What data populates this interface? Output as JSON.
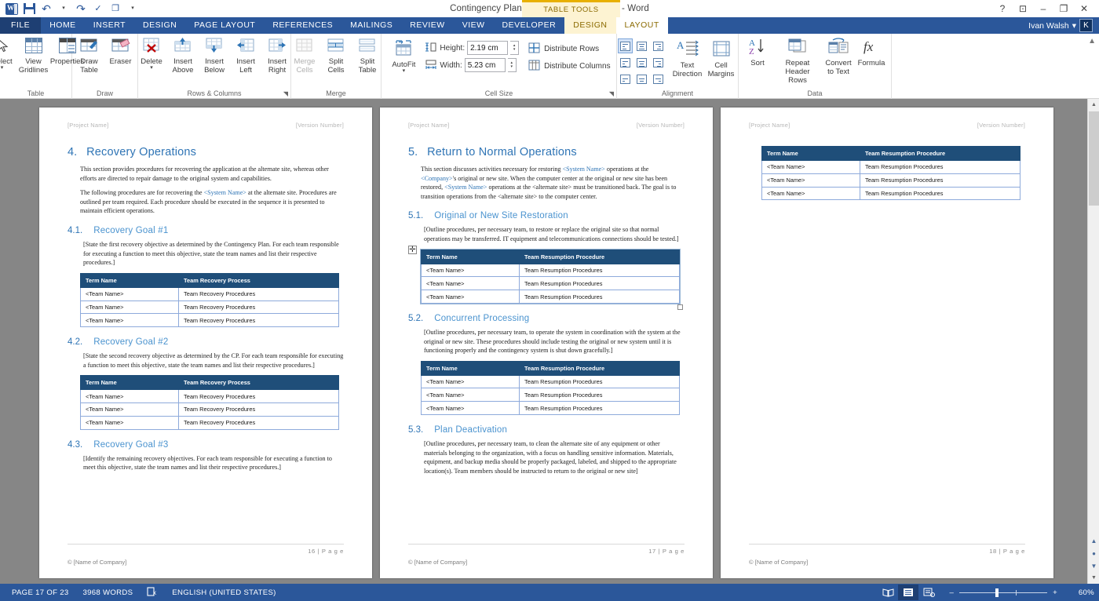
{
  "titlebar": {
    "doc_title": "Contingency Plan Template - Blue Theme - Word",
    "qat": [
      {
        "name": "word-logo",
        "label": "W"
      },
      {
        "name": "save",
        "label": "Save"
      },
      {
        "name": "undo",
        "label": "Undo"
      },
      {
        "name": "redo",
        "label": "Repeat"
      },
      {
        "name": "spelling",
        "label": "Spelling & Grammar"
      },
      {
        "name": "open-recent",
        "label": "Open"
      },
      {
        "name": "customize-qat",
        "label": "Customize Quick Access Toolbar"
      }
    ],
    "context_banner": "TABLE TOOLS",
    "window_controls": [
      "?",
      "ribbon-display",
      "–",
      "❐",
      "✕"
    ],
    "user_name": "Ivan Walsh",
    "avatar_initial": "K"
  },
  "tabs": [
    {
      "label": "FILE",
      "active": false,
      "kind": "file"
    },
    {
      "label": "HOME",
      "active": false,
      "kind": "normal"
    },
    {
      "label": "INSERT",
      "active": false,
      "kind": "normal"
    },
    {
      "label": "DESIGN",
      "active": false,
      "kind": "normal"
    },
    {
      "label": "PAGE LAYOUT",
      "active": false,
      "kind": "normal"
    },
    {
      "label": "REFERENCES",
      "active": false,
      "kind": "normal"
    },
    {
      "label": "MAILINGS",
      "active": false,
      "kind": "normal"
    },
    {
      "label": "REVIEW",
      "active": false,
      "kind": "normal"
    },
    {
      "label": "VIEW",
      "active": false,
      "kind": "normal"
    },
    {
      "label": "DEVELOPER",
      "active": false,
      "kind": "normal"
    },
    {
      "label": "DESIGN",
      "active": false,
      "kind": "context"
    },
    {
      "label": "LAYOUT",
      "active": true,
      "kind": "context"
    }
  ],
  "ribbon": {
    "groups": [
      {
        "name": "table",
        "title": "Table",
        "buttons": [
          {
            "name": "select",
            "label": "Select",
            "sub": "",
            "caret": true
          },
          {
            "name": "view-gridlines",
            "label": "View",
            "sub": "Gridlines",
            "caret": false
          },
          {
            "name": "properties",
            "label": "Properties",
            "sub": "",
            "caret": false
          }
        ]
      },
      {
        "name": "draw",
        "title": "Draw",
        "buttons": [
          {
            "name": "draw-table",
            "label": "Draw",
            "sub": "Table",
            "caret": false
          },
          {
            "name": "eraser",
            "label": "Eraser",
            "sub": "",
            "caret": false
          }
        ]
      },
      {
        "name": "rows-columns",
        "title": "Rows & Columns",
        "buttons": [
          {
            "name": "delete",
            "label": "Delete",
            "sub": "",
            "caret": true
          },
          {
            "name": "insert-above",
            "label": "Insert",
            "sub": "Above",
            "caret": false
          },
          {
            "name": "insert-below",
            "label": "Insert",
            "sub": "Below",
            "caret": false
          },
          {
            "name": "insert-left",
            "label": "Insert",
            "sub": "Left",
            "caret": false
          },
          {
            "name": "insert-right",
            "label": "Insert",
            "sub": "Right",
            "caret": false
          }
        ]
      },
      {
        "name": "merge",
        "title": "Merge",
        "buttons": [
          {
            "name": "merge-cells",
            "label": "Merge",
            "sub": "Cells",
            "caret": false,
            "disabled": true
          },
          {
            "name": "split-cells",
            "label": "Split",
            "sub": "Cells",
            "caret": false
          },
          {
            "name": "split-table",
            "label": "Split",
            "sub": "Table",
            "caret": false
          }
        ]
      },
      {
        "name": "cell-size",
        "title": "Cell Size",
        "autofit": {
          "label": "AutoFit",
          "caret": true
        },
        "height_label": "Height:",
        "height_value": "2.19 cm",
        "width_label": "Width:",
        "width_value": "5.23 cm",
        "distribute_rows": "Distribute Rows",
        "distribute_columns": "Distribute Columns"
      },
      {
        "name": "alignment",
        "title": "Alignment",
        "buttons": [
          {
            "name": "text-direction",
            "label": "Text",
            "sub": "Direction"
          },
          {
            "name": "cell-margins",
            "label": "Cell",
            "sub": "Margins"
          }
        ],
        "align_cells": [
          "align-top-left",
          "align-top-center",
          "align-top-right",
          "align-center-left",
          "align-center",
          "align-center-right",
          "align-bottom-left",
          "align-bottom-center",
          "align-bottom-right"
        ],
        "selected_align": "align-top-left"
      },
      {
        "name": "data",
        "title": "Data",
        "buttons": [
          {
            "name": "sort",
            "label": "Sort",
            "sub": "",
            "icon": "AZ↓"
          },
          {
            "name": "repeat-header-rows",
            "label": "Repeat",
            "sub": "Header Rows"
          },
          {
            "name": "convert-to-text",
            "label": "Convert",
            "sub": "to Text"
          },
          {
            "name": "formula",
            "label": "Formula",
            "sub": "",
            "icon": "fx"
          }
        ]
      }
    ]
  },
  "document": {
    "pages": [
      {
        "name": "page-16",
        "header_left": "[Project Name]",
        "header_right": "[Version Number]",
        "heading1": {
          "num": "4.",
          "text": "Recovery Operations"
        },
        "paras": [
          "This section provides procedures for recovering the application at the alternate site, whereas other efforts are directed to repair damage to the original system and capabilities."
        ],
        "para_with_ph": {
          "a": "The following procedures are for recovering the ",
          "ph": "<System Name>",
          "b": " at the alternate site. Procedures are outlined per team required. Each procedure should be executed in the sequence it is presented to maintain efficient operations."
        },
        "sections": [
          {
            "num": "4.1.",
            "title": "Recovery Goal #1",
            "body": "[State the first recovery objective as determined by the Contingency Plan. For each team responsible for executing a function to meet this objective, state the team names and list their respective procedures.]",
            "table": {
              "headers": [
                "Term Name",
                "Team Recovery Process"
              ],
              "rows": [
                [
                  "<Team Name>",
                  "Team Recovery Procedures"
                ],
                [
                  "<Team Name>",
                  "Team Recovery Procedures"
                ],
                [
                  "<Team Name>",
                  "Team Recovery Procedures"
                ]
              ]
            }
          },
          {
            "num": "4.2.",
            "title": "Recovery Goal #2",
            "body": "[State the second recovery objective as determined by the CP. For each team responsible for executing a function to meet this objective, state the team names and list their respective procedures.]",
            "table": {
              "headers": [
                "Term Name",
                "Team Recovery Process"
              ],
              "rows": [
                [
                  "<Team Name>",
                  "Team Recovery Procedures"
                ],
                [
                  "<Team Name>",
                  "Team Recovery Procedures"
                ],
                [
                  "<Team Name>",
                  "Team Recovery Procedures"
                ]
              ]
            }
          },
          {
            "num": "4.3.",
            "title": "Recovery Goal #3",
            "body": "[Identify the remaining recovery objectives. For each team responsible for executing a function to meet this objective, state the team names and list their respective procedures.]",
            "table": null
          }
        ],
        "footer_page": "16 | P a g e",
        "footer_company": "© [Name of Company]"
      },
      {
        "name": "page-17",
        "header_left": "[Project Name]",
        "header_right": "[Version Number]",
        "heading1": {
          "num": "5.",
          "text": "Return to Normal Operations"
        },
        "intro": {
          "a": "This section discusses activities necessary for restoring ",
          "ph1": "<System Name>",
          "b": " operations at the ",
          "ph2": "<Company>",
          "c": "'s original or new site. When the computer center at the original or new site has been restored, ",
          "ph3": "<System Name>",
          "d": " operations at the <alternate site> must be transitioned back. The goal is to transition operations from the <alternate site> to the computer center."
        },
        "sections": [
          {
            "num": "5.1.",
            "title": "Original or New Site Restoration",
            "body": "[Outline procedures, per necessary team, to restore or replace the original site so that normal operations may be transferred. IT equipment and telecommunications connections should be tested.]",
            "selected": true,
            "table": {
              "headers": [
                "Term Name",
                "Team Resumption Procedure"
              ],
              "rows": [
                [
                  "<Team Name>",
                  "Team Resumption Procedures"
                ],
                [
                  "<Team Name>",
                  "Team Resumption Procedures"
                ],
                [
                  "<Team Name>",
                  "Team Resumption Procedures"
                ]
              ]
            }
          },
          {
            "num": "5.2.",
            "title": "Concurrent Processing",
            "body": "[Outline procedures, per necessary team, to operate the system in coordination with the system at the original or new site. These procedures should include testing the original or new system until it is functioning properly and the contingency system is shut down gracefully.]",
            "selected": false,
            "table": {
              "headers": [
                "Term Name",
                "Team Resumption Procedure"
              ],
              "rows": [
                [
                  "<Team Name>",
                  "Team Resumption Procedures"
                ],
                [
                  "<Team Name>",
                  "Team Resumption Procedures"
                ],
                [
                  "<Team Name>",
                  "Team Resumption Procedures"
                ]
              ]
            }
          },
          {
            "num": "5.3.",
            "title": "Plan Deactivation",
            "body": "[Outline procedures, per necessary team, to clean the alternate site of any equipment or other materials belonging to the organization, with a focus on handling sensitive information. Materials, equipment, and backup media should be properly packaged, labeled, and shipped to the appropriate location(s). Team members should be instructed to return to the original or new site]",
            "selected": false,
            "table": null
          }
        ],
        "footer_page": "17 | P a g e",
        "footer_company": "© [Name of Company]"
      },
      {
        "name": "page-18",
        "header_left": "[Project Name]",
        "header_right": "[Version Number]",
        "table": {
          "headers": [
            "Term Name",
            "Team Resumption Procedure"
          ],
          "rows": [
            [
              "<Team Name>",
              "Team Resumption Procedures"
            ],
            [
              "<Team Name>",
              "Team Resumption Procedures"
            ],
            [
              "<Team Name>",
              "Team Resumption Procedures"
            ]
          ]
        },
        "footer_page": "18 | P a g e",
        "footer_company": "© [Name of Company]"
      }
    ]
  },
  "statusbar": {
    "page_info": "PAGE 17 OF 23",
    "word_count": "3968 WORDS",
    "proofing_icon": "proofing-errors-icon",
    "language": "ENGLISH (UNITED STATES)",
    "views": [
      {
        "name": "read-mode",
        "glyph": "📖",
        "active": false
      },
      {
        "name": "print-layout",
        "glyph": "▤",
        "active": true
      },
      {
        "name": "web-layout",
        "glyph": "🖹",
        "active": false
      }
    ],
    "zoom_out": "–",
    "zoom_in": "+",
    "zoom_level": "60%"
  },
  "colors": {
    "word_blue": "#2b579a",
    "table_header": "#1f4e79",
    "table_border": "#8eaadb",
    "heading_blue": "#2e74b5",
    "context_yellow": "#e8b000"
  }
}
